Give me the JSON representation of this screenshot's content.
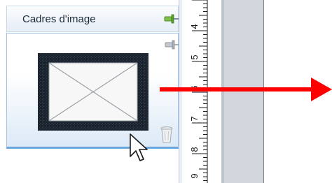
{
  "panel": {
    "title": "Cadres d'image",
    "header_pin_icon": "pin-icon",
    "item": {
      "name": "image-frame",
      "pin_icon": "pin-icon",
      "delete_icon": "trash-icon"
    }
  },
  "ruler": {
    "labels": [
      "4",
      "5",
      "6",
      "7",
      "8",
      "9"
    ]
  },
  "colors": {
    "arrow": "#ff0000",
    "card_border": "#6aa6de",
    "frame_border": "#1c2430"
  },
  "cursor": "arrow-cursor-icon"
}
